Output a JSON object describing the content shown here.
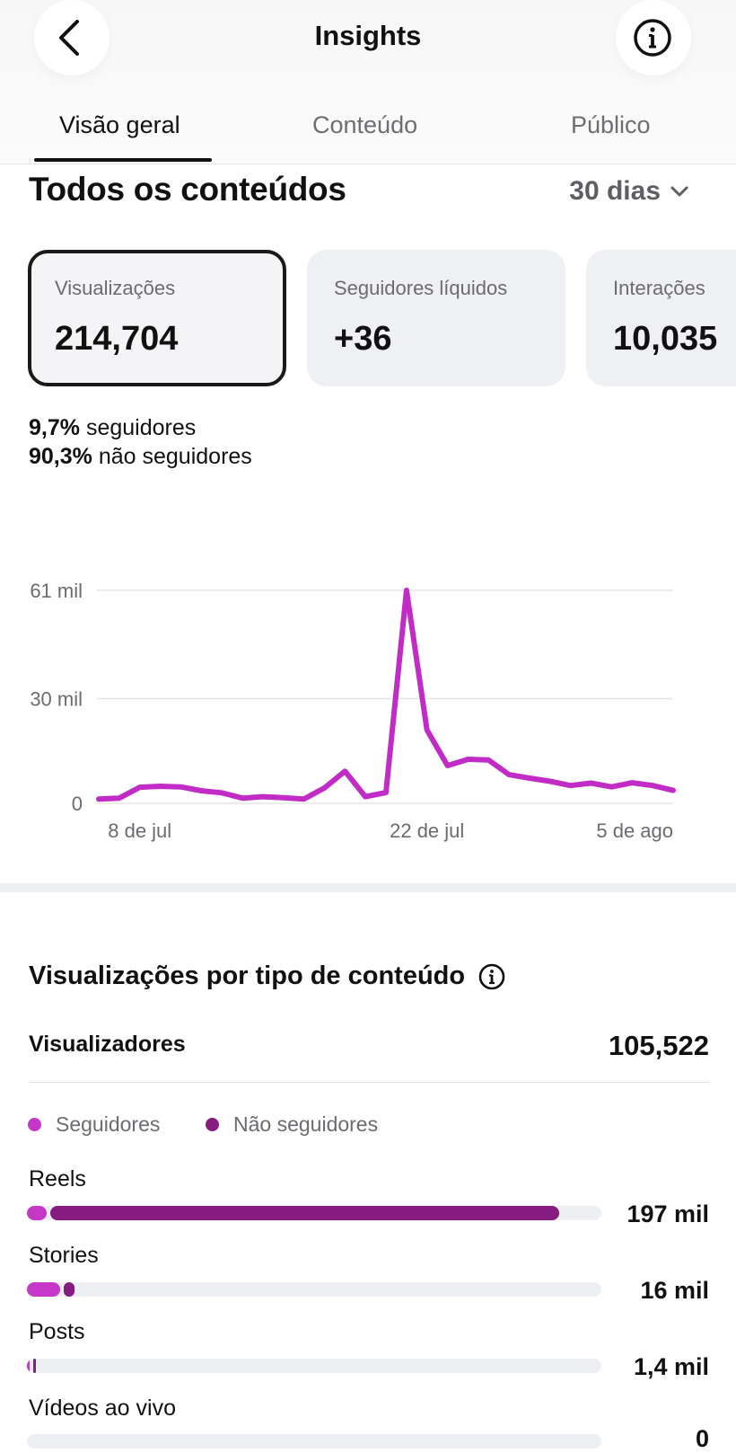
{
  "header": {
    "title": "Insights",
    "back_icon": "chevron-left-icon",
    "info_icon": "info-circle-icon"
  },
  "tabs": [
    {
      "label": "Visão geral",
      "active": true
    },
    {
      "label": "Conteúdo",
      "active": false
    },
    {
      "label": "Público",
      "active": false
    }
  ],
  "overview": {
    "title": "Todos os conteúdos",
    "range": "30 dias",
    "range_icon": "chevron-down-icon"
  },
  "metrics": [
    {
      "label": "Visualizações",
      "value": "214,704",
      "selected": true
    },
    {
      "label": "Seguidores líquidos",
      "value": "+36",
      "selected": false
    },
    {
      "label": "Interações",
      "value": "10,035",
      "selected": false
    }
  ],
  "audience_split": {
    "followers_pct": "9,7%",
    "followers_text": "seguidores",
    "non_followers_pct": "90,3%",
    "non_followers_text": "não seguidores"
  },
  "chart_data": {
    "type": "line",
    "title": "",
    "xlabel": "",
    "ylabel": "",
    "x": [
      "6 de jul",
      "7 de jul",
      "8 de jul",
      "9 de jul",
      "10 de jul",
      "11 de jul",
      "12 de jul",
      "13 de jul",
      "14 de jul",
      "15 de jul",
      "16 de jul",
      "17 de jul",
      "18 de jul",
      "19 de jul",
      "20 de jul",
      "21 de jul",
      "22 de jul",
      "23 de jul",
      "24 de jul",
      "25 de jul",
      "26 de jul",
      "27 de jul",
      "28 de jul",
      "29 de jul",
      "30 de jul",
      "31 de jul",
      "1 de ago",
      "2 de ago",
      "3 de ago",
      "4 de ago",
      "5 de ago"
    ],
    "values": [
      1200,
      1500,
      4600,
      4900,
      4700,
      3600,
      3000,
      1500,
      1900,
      1600,
      1200,
      4400,
      9200,
      1900,
      3100,
      61000,
      21000,
      10800,
      12600,
      12400,
      8200,
      7200,
      6300,
      5100,
      5800,
      4700,
      5900,
      5100,
      3700
    ],
    "x_ticks": [
      "8 de jul",
      "22 de jul",
      "5 de ago"
    ],
    "y_ticks": [
      "0",
      "30 mil",
      "61 mil"
    ],
    "y_tick_values": [
      0,
      30000,
      61000
    ],
    "ylim": [
      0,
      61000
    ],
    "grid": true,
    "line_color": "#c02cc5"
  },
  "breakdown": {
    "title": "Visualizações por tipo de conteúdo",
    "info_icon": "info-circle-icon",
    "viewers_label": "Visualizadores",
    "viewers_value": "105,522",
    "legend": [
      {
        "label": "Seguidores",
        "color": "#c637c8"
      },
      {
        "label": "Não seguidores",
        "color": "#861c80"
      }
    ],
    "rows": [
      {
        "label": "Reels",
        "value": "197 mil",
        "followers": 0.035,
        "non_followers": 0.885
      },
      {
        "label": "Stories",
        "value": "16 mil",
        "followers": 0.058,
        "non_followers": 0.018
      },
      {
        "label": "Posts",
        "value": "1,4 mil",
        "followers": 0.004,
        "non_followers": 0.006
      },
      {
        "label": "Vídeos ao vivo",
        "value": "0",
        "followers": 0,
        "non_followers": 0
      }
    ]
  }
}
